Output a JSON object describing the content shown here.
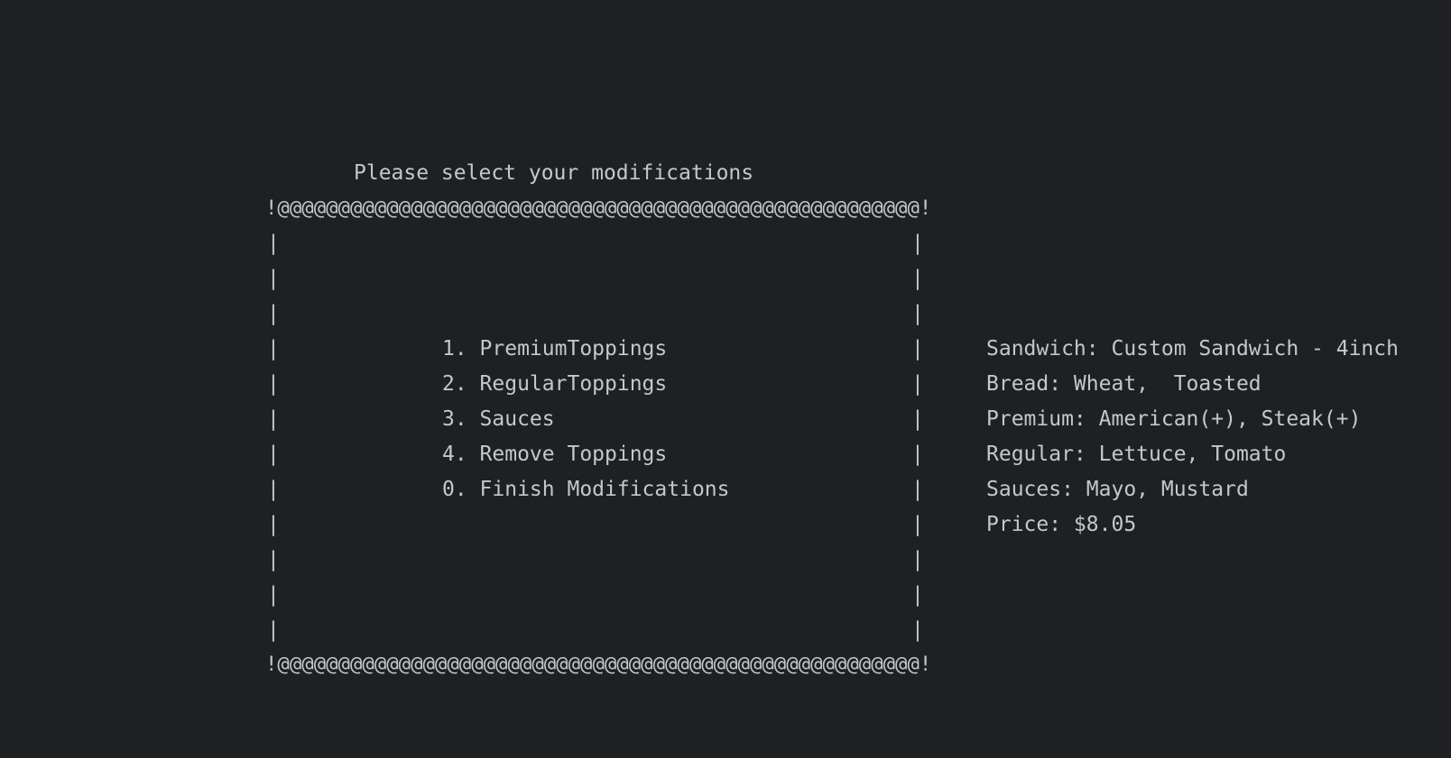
{
  "prompt": {
    "title": "Please select your modifications"
  },
  "box": {
    "top_border": "!@@@@@@@@@@@@@@@@@@@@@@@@@@@@@@@@@@@@@@@@@@@@@@@@@@@@@!",
    "bottom_border": "!@@@@@@@@@@@@@@@@@@@@@@@@@@@@@@@@@@@@@@@@@@@@@@@@@@@@@!",
    "side_char": "|"
  },
  "menu": {
    "items": [
      "1. PremiumToppings",
      "2. RegularToppings",
      "3. Sauces",
      "4. Remove Toppings",
      "0. Finish Modifications"
    ]
  },
  "summary": {
    "lines": [
      "Sandwich: Custom Sandwich - 4inch",
      "Bread: Wheat,  Toasted",
      "Premium: American(+), Steak(+)",
      "Regular: Lettuce, Tomato",
      "Sauces: Mayo, Mustard",
      "Price: $8.05"
    ]
  },
  "colors": {
    "background": "#1f2023",
    "text": "#c4c7cc"
  }
}
